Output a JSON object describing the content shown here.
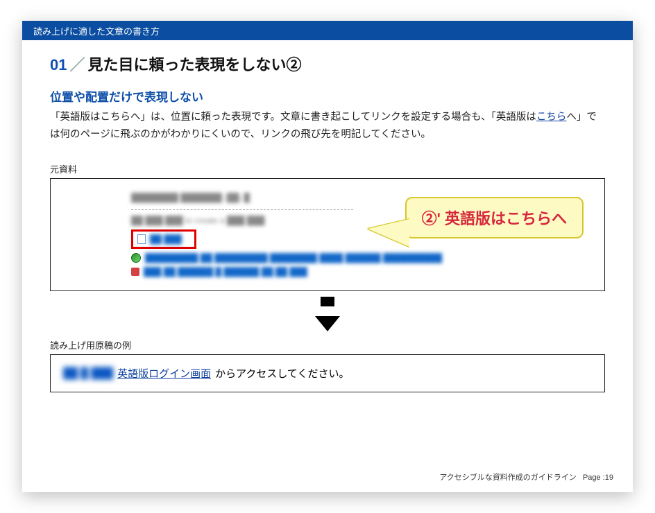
{
  "header": {
    "bar_title": "読み上げに適した文章の書き方"
  },
  "title": {
    "number": "01",
    "slash": "／",
    "text": "見た目に頼った表現をしない②"
  },
  "section": {
    "heading": "位置や配置だけで表現しない",
    "body_pre": "「英語版はこちらへ」は、位置に頼った表現です。文章に書き起こしてリンクを設定する場合も、「英語版は",
    "body_link": "こちら",
    "body_post": "へ」では何のページに飛ぶのかがわかりにくいので、リンクの飛び先を明記してください。"
  },
  "source_caption": "元資料",
  "callout_text": "②' 英語版はこちらへ",
  "example_caption": "読み上げ用原稿の例",
  "example": {
    "link_text": "英語版ログイン画面",
    "tail_text": "からアクセスしてください。"
  },
  "footer": {
    "label": "アクセシブルな資料作成のガイドライン",
    "page_prefix": "Page :",
    "page_no": "19"
  }
}
